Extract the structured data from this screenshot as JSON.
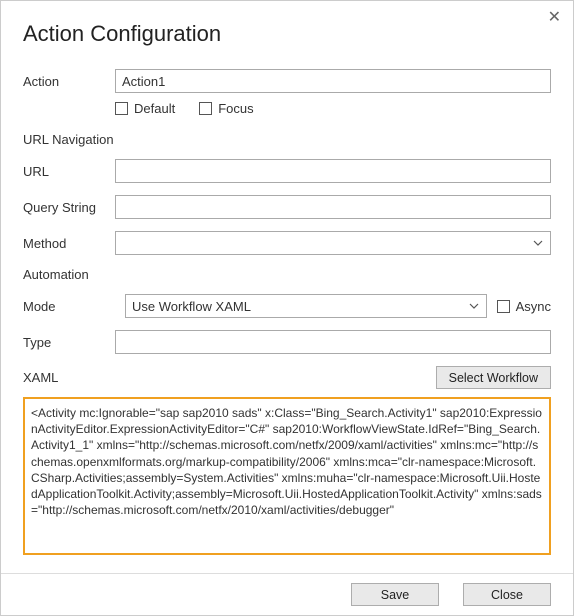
{
  "title": "Action Configuration",
  "labels": {
    "action": "Action",
    "default": "Default",
    "focus": "Focus",
    "url_navigation": "URL Navigation",
    "url": "URL",
    "query_string": "Query String",
    "method": "Method",
    "automation": "Automation",
    "mode": "Mode",
    "async": "Async",
    "type": "Type",
    "xaml": "XAML"
  },
  "values": {
    "action": "Action1",
    "url": "",
    "query_string": "",
    "method": "",
    "mode": "Use Workflow XAML",
    "type": ""
  },
  "buttons": {
    "select_workflow": "Select Workflow",
    "save": "Save",
    "close": "Close"
  },
  "xaml_content": "<Activity mc:Ignorable=\"sap sap2010 sads\" x:Class=\"Bing_Search.Activity1\" sap2010:ExpressionActivityEditor.ExpressionActivityEditor=\"C#\" sap2010:WorkflowViewState.IdRef=\"Bing_Search.Activity1_1\"\n xmlns=\"http://schemas.microsoft.com/netfx/2009/xaml/activities\"\n xmlns:mc=\"http://schemas.openxmlformats.org/markup-compatibility/2006\"\n xmlns:mca=\"clr-namespace:Microsoft.CSharp.Activities;assembly=System.Activities\"\n xmlns:muha=\"clr-namespace:Microsoft.Uii.HostedApplicationToolkit.Activity;assembly=Microsoft.Uii.HostedApplicationToolkit.Activity\"\n xmlns:sads=\"http://schemas.microsoft.com/netfx/2010/xaml/activities/debugger\""
}
